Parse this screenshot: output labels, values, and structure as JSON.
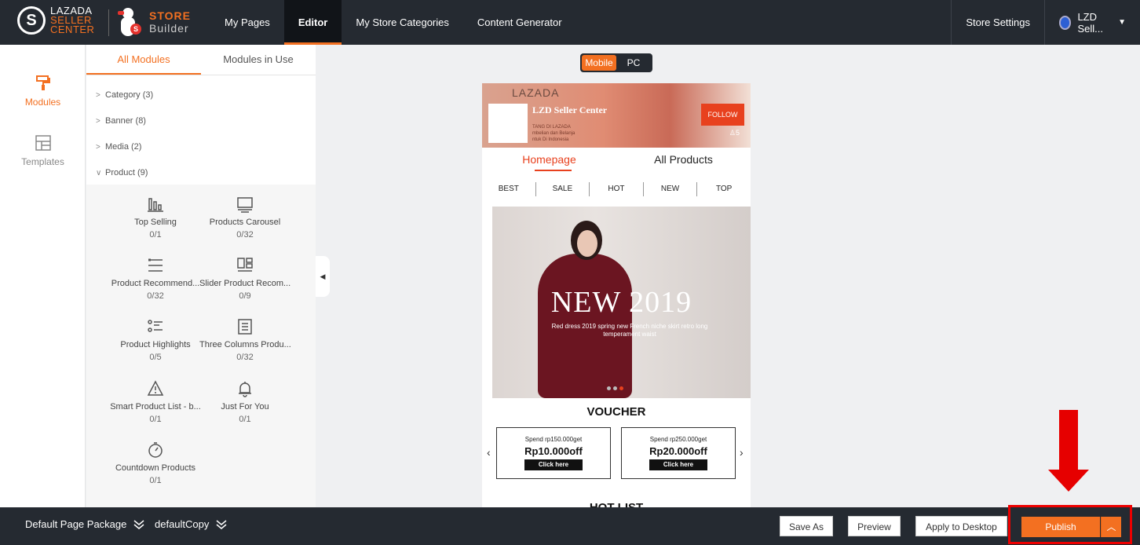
{
  "brand": {
    "lazada_line1": "LAZADA",
    "lazada_line2": "SELLER",
    "lazada_line3": "CENTER",
    "store_line1": "STORE",
    "store_line2": "Builder"
  },
  "nav": {
    "items": [
      {
        "label": "My Pages",
        "active": false
      },
      {
        "label": "Editor",
        "active": true
      },
      {
        "label": "My Store Categories",
        "active": false
      },
      {
        "label": "Content Generator",
        "active": false
      }
    ]
  },
  "topright": {
    "store_settings": "Store Settings",
    "user": "LZD Sell..."
  },
  "rail": {
    "modules": "Modules",
    "templates": "Templates"
  },
  "panel": {
    "tab_all": "All Modules",
    "tab_in_use": "Modules in Use",
    "categories": [
      {
        "label": "Category (3)",
        "expanded": false
      },
      {
        "label": "Banner (8)",
        "expanded": false
      },
      {
        "label": "Media (2)",
        "expanded": false
      },
      {
        "label": "Product (9)",
        "expanded": true
      }
    ],
    "modules": [
      {
        "name": "Top Selling",
        "count": "0/1",
        "icon": "bar-chart-icon"
      },
      {
        "name": "Products Carousel",
        "count": "0/32",
        "icon": "monitor-icon"
      },
      {
        "name": "Product Recommend...",
        "count": "0/32",
        "icon": "list-icon"
      },
      {
        "name": "Slider Product Recom...",
        "count": "0/9",
        "icon": "grid-icon"
      },
      {
        "name": "Product Highlights",
        "count": "0/5",
        "icon": "checklist-icon"
      },
      {
        "name": "Three Columns Produ...",
        "count": "0/32",
        "icon": "document-icon"
      },
      {
        "name": "Smart Product List - b...",
        "count": "0/1",
        "icon": "warning-icon"
      },
      {
        "name": "Just For You",
        "count": "0/1",
        "icon": "bell-icon"
      },
      {
        "name": "Countdown Products",
        "count": "0/1",
        "icon": "stopwatch-icon"
      }
    ]
  },
  "toggle": {
    "mobile": "Mobile",
    "pc": "PC"
  },
  "preview": {
    "lazada": "LAZADA",
    "store_name": "LZD Seller Center",
    "banner_sub1": "TANG DI LAZADA",
    "banner_sub2": "mbelian dan Belanja",
    "banner_sub3": "ntuk Di Indonesia",
    "follow": "FOLLOW",
    "followers": "5",
    "tab_home": "Homepage",
    "tab_all": "All Products",
    "filters": [
      "BEST",
      "SALE",
      "HOT",
      "NEW",
      "TOP"
    ],
    "hero_title": "NEW 2019",
    "hero_sub": "Red dress 2019 spring new French niche skirt retro long temperament waist",
    "voucher_title": "VOUCHER",
    "vouchers": [
      {
        "spend": "Spend rp150.000get",
        "amount": "Rp10.000off",
        "cta": "Click here"
      },
      {
        "spend": "Spend rp250.000get",
        "amount": "Rp20.000off",
        "cta": "Click here"
      }
    ],
    "hotlist": "HOT LIST"
  },
  "bottom": {
    "package": "Default Page Package",
    "copy": "defaultCopy",
    "save_as": "Save As",
    "preview": "Preview",
    "apply_desktop": "Apply to Desktop",
    "publish": "Publish"
  },
  "colors": {
    "accent": "#f37021",
    "topbar": "#252a31",
    "annotation": "#e60000"
  }
}
